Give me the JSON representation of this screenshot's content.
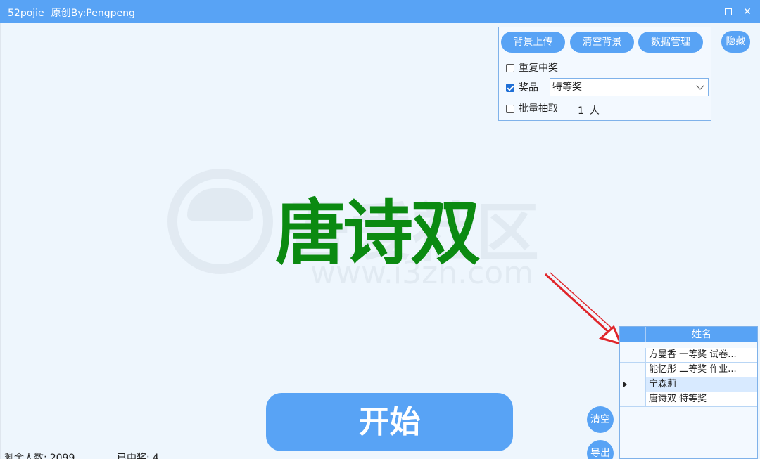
{
  "window": {
    "app_name": "52pojie",
    "credit": "原创By:Pengpeng",
    "minimize_icon": "minimize-icon",
    "maximize_icon": "maximize-icon",
    "close_glyph": "✕"
  },
  "controls": {
    "upload_bg": "背景上传",
    "clear_bg": "清空背景",
    "data_manage": "数据管理",
    "hide": "隐藏",
    "repeat_win": {
      "label": "重复中奖",
      "checked": false
    },
    "prize": {
      "label": "奖品",
      "checked": true,
      "selected": "特等奖"
    },
    "batch_draw": {
      "label": "批量抽取",
      "checked": false,
      "count": "1",
      "unit": "人"
    }
  },
  "watermark": {
    "text": "吾爱社区",
    "url": "www.i3zh.com"
  },
  "winner_name": "唐诗双",
  "winners_table": {
    "header": "姓名",
    "rows": [
      {
        "text": "方曼香 一等奖 试卷...",
        "selected": false
      },
      {
        "text": "能忆彤 二等奖 作业...",
        "selected": false
      },
      {
        "text": "宁森莉",
        "selected": true
      },
      {
        "text": "唐诗双 特等奖",
        "selected": false
      }
    ]
  },
  "start_button": "开始",
  "clear_button": "清空",
  "export_button": "导出",
  "status": {
    "remaining_label": "剩余人数:",
    "remaining_value": "2099",
    "won_label": "已中奖:",
    "won_value": "4"
  },
  "colors": {
    "accent": "#58a3f5",
    "winner_text": "#0b8a11",
    "background": "#eef6fd"
  }
}
